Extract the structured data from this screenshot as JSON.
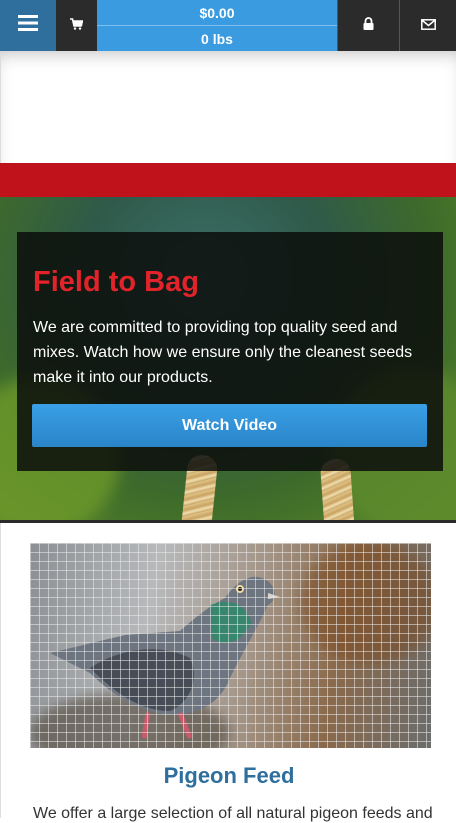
{
  "header": {
    "cart_total": "$0.00",
    "cart_weight": "0 lbs"
  },
  "hero": {
    "title": "Field to Bag",
    "text": "We are committed to providing top quality seed and mixes. Watch how we ensure only the cleanest seeds make it into our products.",
    "button_label": "Watch Video"
  },
  "product": {
    "title": "Pigeon Feed",
    "description": "We offer a large selection of all natural pigeon feeds and"
  },
  "colors": {
    "nav_dark": "#2b2b2b",
    "menu_blue": "#2f6f9e",
    "cart_blue": "#3a9be0",
    "brand_red": "#c0121a",
    "title_red": "#e2232a",
    "heading_blue": "#2f6f9e"
  },
  "icons": [
    "hamburger-menu-icon",
    "shopping-cart-icon",
    "lock-icon",
    "envelope-icon"
  ]
}
